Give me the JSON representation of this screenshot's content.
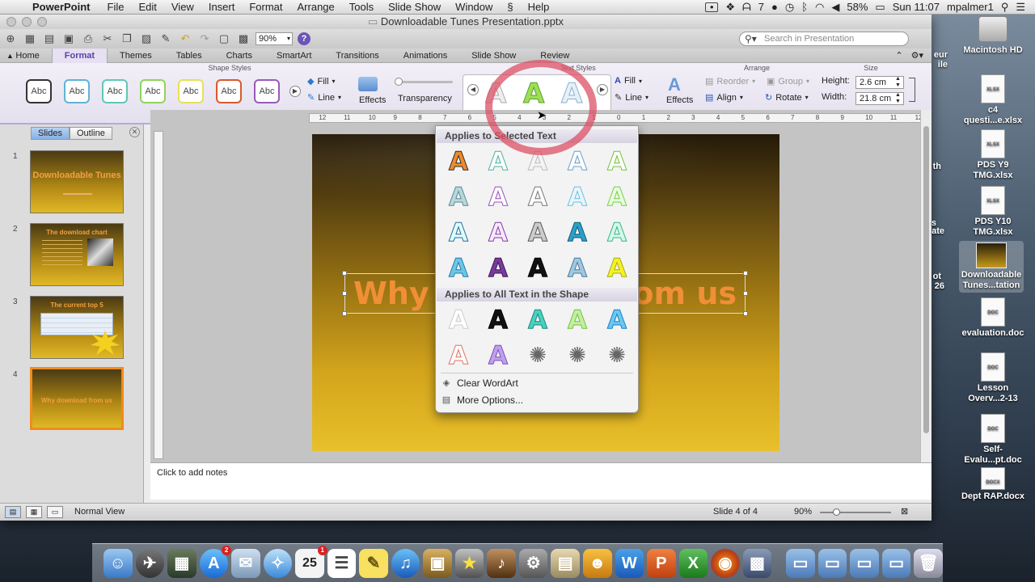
{
  "menubar": {
    "app_name": "PowerPoint",
    "menus": [
      "File",
      "Edit",
      "View",
      "Insert",
      "Format",
      "Arrange",
      "Tools",
      "Slide Show",
      "Window",
      "Help"
    ],
    "battery": "58%",
    "clock": "Sun 11:07",
    "user": "mpalmer1",
    "adobe_count": "7"
  },
  "window": {
    "title": "Downloadable Tunes Presentation.pptx",
    "zoom": "90%",
    "help": "?",
    "search_placeholder": "Search in Presentation"
  },
  "ribbon": {
    "tabs": [
      "Home",
      "Format",
      "Themes",
      "Tables",
      "Charts",
      "SmartArt",
      "Transitions",
      "Animations",
      "Slide Show",
      "Review"
    ],
    "active_tab": "Format",
    "groups": {
      "shape_styles": "Shape Styles",
      "text_styles": "Text Styles",
      "arrange": "Arrange",
      "size": "Size"
    },
    "shape_style_label": "Abc",
    "fill": "Fill",
    "line": "Line",
    "effects": "Effects",
    "transparency": "Transparency",
    "text_fill": "Fill",
    "text_line": "Line",
    "text_effects": "Effects",
    "wordart_glyph": "A",
    "reorder": "Reorder",
    "group": "Group",
    "align": "Align",
    "rotate": "Rotate",
    "height_label": "Height:",
    "height_value": "2.6 cm",
    "width_label": "Width:",
    "width_value": "21.8 cm"
  },
  "sidebar": {
    "tab_slides": "Slides",
    "tab_outline": "Outline",
    "slides": [
      {
        "num": "1",
        "title": "Downloadable Tunes"
      },
      {
        "num": "2",
        "title": "The download chart"
      },
      {
        "num": "3",
        "title": "The current top 5"
      },
      {
        "num": "4",
        "title": "Why download from us"
      }
    ]
  },
  "ruler": {
    "labels": [
      "12",
      "11",
      "10",
      "9",
      "8",
      "7",
      "6",
      "5",
      "4",
      "3",
      "2",
      "1",
      "0",
      "1",
      "2",
      "3",
      "4",
      "5",
      "6",
      "7",
      "8",
      "9",
      "10",
      "11",
      "12"
    ]
  },
  "slide": {
    "text_left": "Why",
    "text_right": "om us"
  },
  "popup": {
    "section_selected": "Applies to Selected Text",
    "section_all": "Applies to All Text in the Shape",
    "glyph": "A",
    "clear": "Clear WordArt",
    "more": "More Options..."
  },
  "notes": {
    "placeholder": "Click to add notes"
  },
  "status": {
    "view": "Normal View",
    "slide": "Slide 4 of 4",
    "zoom": "90%"
  },
  "desktop": {
    "icons": [
      "Macintosh HD",
      "c4 questi...e.xlsx",
      "PDS Y9 TMG.xlsx",
      "PDS Y10 TMG.xlsx",
      "Downloadable Tunes...tation",
      "evaluation.doc",
      "Lesson Overv...2-13",
      "Self-Evalu...pt.doc",
      "Dept RAP.docx"
    ],
    "partial_labels": [
      "eur",
      "ile",
      "th",
      "s",
      "ate",
      "ot",
      "26"
    ]
  },
  "dock": {
    "calendar_day": "25",
    "badge_app_store": "2",
    "badge_calendar": "1"
  },
  "colors": {
    "accent": "#5b3fa8",
    "slide_text": "#f08f36",
    "selected_thumb": "#f08c1a",
    "highlight_circle": "#dc5064"
  }
}
